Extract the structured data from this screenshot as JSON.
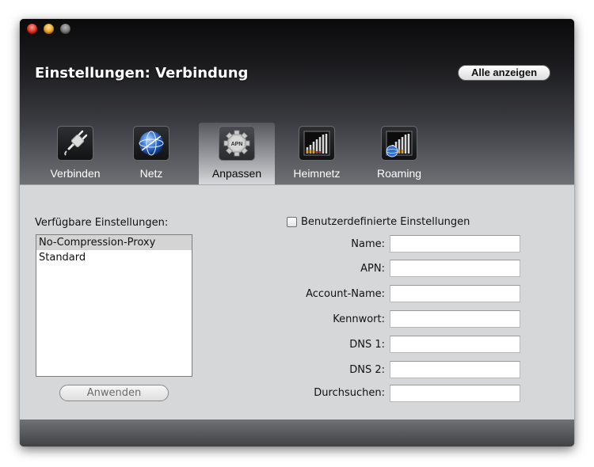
{
  "window": {
    "title": "Einstellungen: Verbindung",
    "show_all_label": "Alle anzeigen"
  },
  "tabs": [
    {
      "label": "Verbinden",
      "icon": "plug-icon"
    },
    {
      "label": "Netz",
      "icon": "globe-icon"
    },
    {
      "label": "Anpassen",
      "icon": "apn-gear-icon",
      "icon_text": "APN",
      "selected": true
    },
    {
      "label": "Heimnetz",
      "icon": "signal-bars-icon"
    },
    {
      "label": "Roaming",
      "icon": "signal-bars-globe-icon"
    }
  ],
  "settings": {
    "available_label": "Verfügbare Einstellungen:",
    "items": [
      "No-Compression-Proxy",
      "Standard"
    ],
    "selected_item": "No-Compression-Proxy",
    "apply_label": "Anwenden"
  },
  "custom": {
    "checkbox_label": "Benutzerdefinierte Einstellungen",
    "checked": false,
    "fields": [
      {
        "label": "Name:",
        "value": ""
      },
      {
        "label": "APN:",
        "value": ""
      },
      {
        "label": "Account-Name:",
        "value": ""
      },
      {
        "label": "Kennwort:",
        "value": ""
      },
      {
        "label": "DNS 1:",
        "value": ""
      },
      {
        "label": "DNS 2:",
        "value": ""
      },
      {
        "label": "Durchsuchen:",
        "value": ""
      }
    ]
  },
  "colors": {
    "panel_bg": "#d6d7d9",
    "list_selection": "#d4d4d4"
  }
}
